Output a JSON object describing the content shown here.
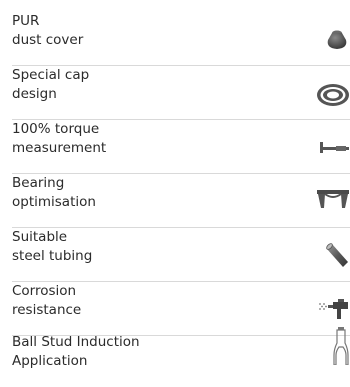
{
  "features": [
    {
      "line1": "PUR",
      "line2": "dust cover",
      "icon": "dust-cap-icon"
    },
    {
      "line1": "Special cap",
      "line2": "design",
      "icon": "cap-ring-icon"
    },
    {
      "line1": "100% torque",
      "line2": "measurement",
      "icon": "torque-wrench-icon"
    },
    {
      "line1": "Bearing",
      "line2": "optimisation",
      "icon": "bearing-icon"
    },
    {
      "line1": "Suitable",
      "line2": "steel tubing",
      "icon": "steel-tube-icon"
    },
    {
      "line1": "Corrosion",
      "line2": "resistance",
      "icon": "spray-gun-icon"
    },
    {
      "line1": "Ball Stud Induction",
      "line2": "Application",
      "icon": "ball-stud-icon"
    }
  ],
  "colors": {
    "text": "#2b2b2b",
    "divider": "#d9d9d9",
    "icon": "#555555"
  }
}
